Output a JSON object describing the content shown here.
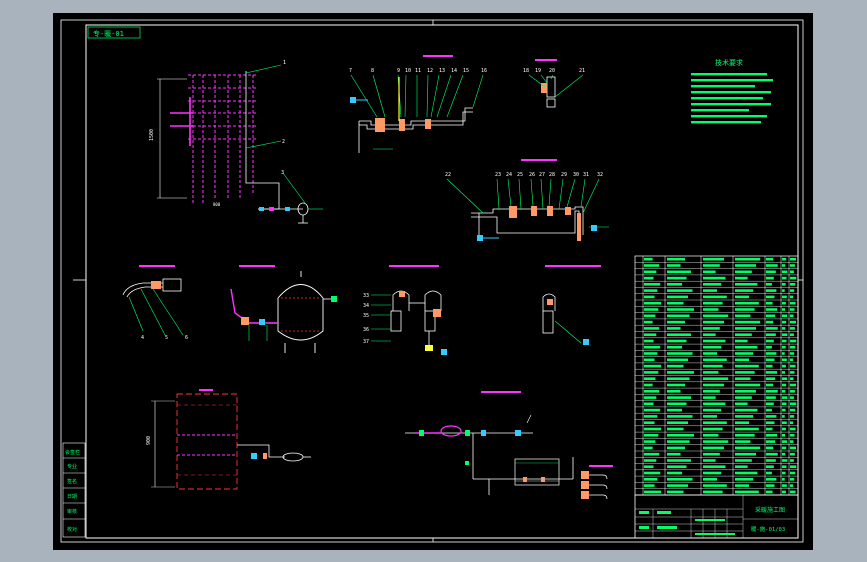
{
  "app": {
    "viewport_background": "#a8b3bd",
    "canvas_background": "#000000"
  },
  "colors": {
    "frame": "#ffffff",
    "green": "#00ff66",
    "magenta": "#ff33ff",
    "cyan": "#33ccff",
    "red": "#ff2222",
    "yellow": "#ffff33",
    "white": "#ffffff",
    "orange": "#ff9966"
  },
  "drawing": {
    "top_left_tag": "专-暖-01",
    "title_block": {
      "drawing_title": "采暖施工图",
      "drawing_number": "暖-施-01/03"
    },
    "tech_notes": {
      "title": "技术要求"
    },
    "left_column_labels": [
      "会签栏",
      "专业",
      "签名",
      "日期",
      "审核",
      "校对"
    ]
  }
}
